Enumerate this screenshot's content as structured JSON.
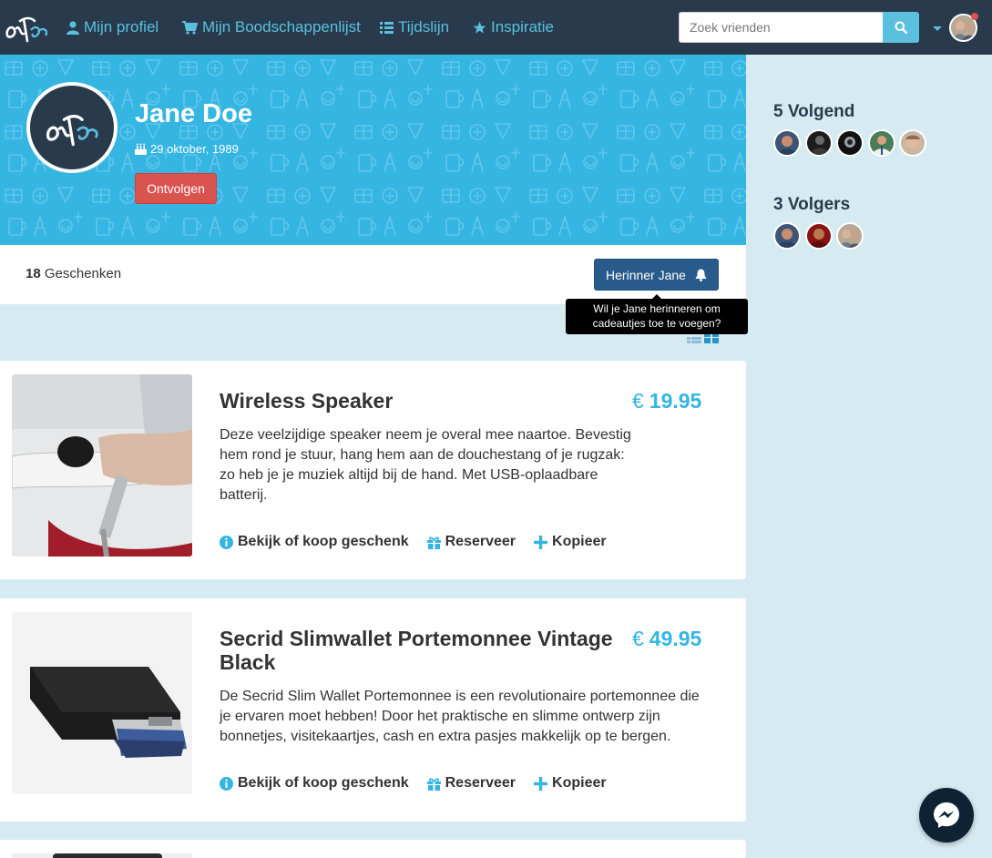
{
  "navbar": {
    "logo_icon": "brand-logo-icon",
    "items": [
      {
        "label": "Mijn profiel",
        "icon": "user-icon"
      },
      {
        "label": "Mijn Boodschappenlijst",
        "icon": "shopping-cart-icon"
      },
      {
        "label": "Tijdslijn",
        "icon": "list-icon"
      },
      {
        "label": "Inspiratie",
        "icon": "star-icon"
      }
    ],
    "search": {
      "placeholder": "Zoek vrienden",
      "value": ""
    },
    "accent_color": "#5bc0de",
    "background_color": "#283a4c"
  },
  "profile": {
    "name": "Jane Doe",
    "birthday": "29 oktober, 1989",
    "unfollow_label": "Ontvolgen",
    "hero_color": "#35b5e2"
  },
  "gifts_bar": {
    "count": "18",
    "count_label": " Geschenken",
    "remind_label": "Herinner Jane",
    "tooltip_line1": "Wil je Jane herinneren om",
    "tooltip_line2": "cadeautjes toe te voegen?"
  },
  "gifts": [
    {
      "title": "Wireless Speaker",
      "currency": "€",
      "price": "19.95",
      "description": "Deze veelzijdige speaker neem je overal mee naartoe. Bevestig hem rond je stuur, hang hem aan de douchestang of je rugzak: zo heb je je muziek altijd bij de hand. Met USB-oplaadbare batterij.",
      "actions": [
        {
          "label": "Bekijk of koop geschenk",
          "icon": "info-icon"
        },
        {
          "label": "Reserveer",
          "icon": "gift-icon"
        },
        {
          "label": "Kopieer",
          "icon": "plus-icon"
        }
      ]
    },
    {
      "title": "Secrid Slimwallet Portemonnee Vintage Black",
      "currency": "€",
      "price": "49.95",
      "description": "De Secrid Slim Wallet Portemonnee is een revolutionaire portemonnee die je ervaren moet hebben! Door het praktische en slimme ontwerp zijn bonnetjes, visitekaartjes, cash en extra pasjes makkelijk op te bergen.",
      "actions": [
        {
          "label": "Bekijk of koop geschenk",
          "icon": "info-icon"
        },
        {
          "label": "Reserveer",
          "icon": "gift-icon"
        },
        {
          "label": "Kopieer",
          "icon": "plus-icon"
        }
      ]
    }
  ],
  "sidebar": {
    "following_count": "5",
    "following_label": "Volgend",
    "followers_count": "3",
    "followers_label": "Volgers"
  },
  "messenger_icon": "messenger-icon"
}
